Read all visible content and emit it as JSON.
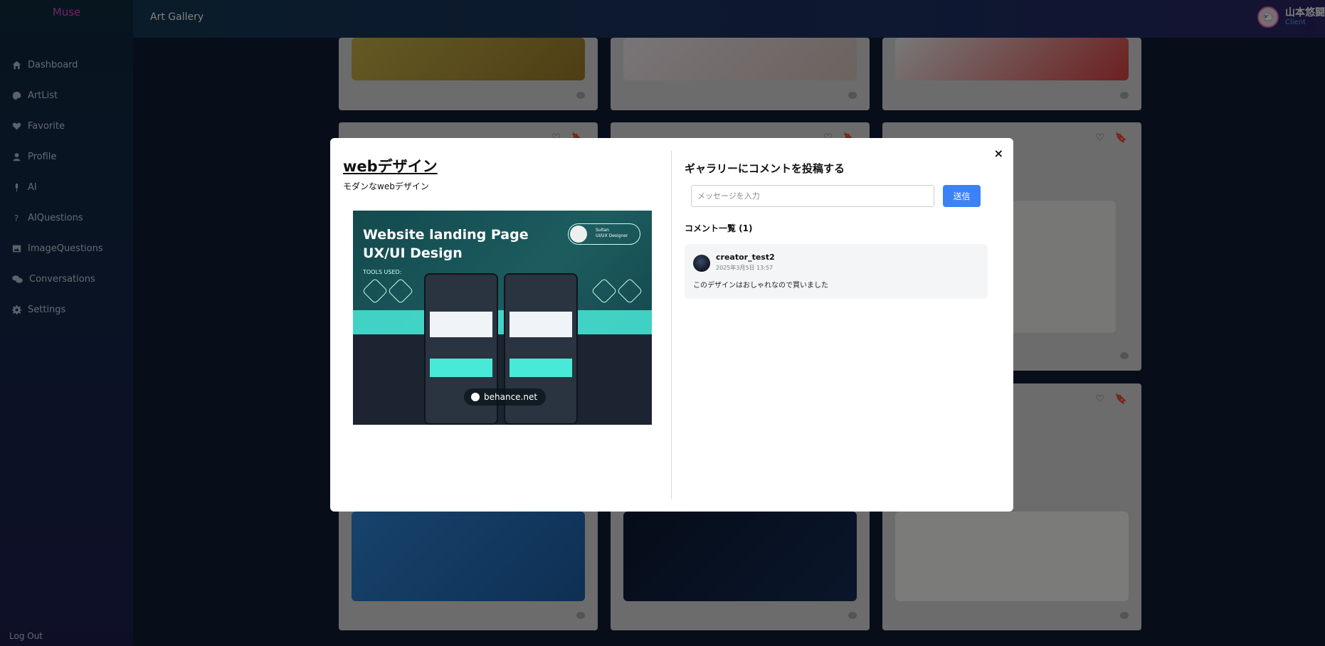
{
  "sidebar": {
    "brand": "Muse",
    "items": [
      {
        "label": "Dashboard",
        "icon": "home-icon"
      },
      {
        "label": "ArtList",
        "icon": "palette-icon"
      },
      {
        "label": "Favorite",
        "icon": "heart-icon"
      },
      {
        "label": "Profile",
        "icon": "user-icon"
      },
      {
        "label": "AI",
        "icon": "microphone-icon"
      },
      {
        "label": "AIQuestions",
        "icon": "question-icon"
      },
      {
        "label": "ImageQuestions",
        "icon": "image-icon"
      },
      {
        "label": "Conversations",
        "icon": "chat-icon"
      },
      {
        "label": "Settings",
        "icon": "gear-icon"
      }
    ],
    "logout_label": "Log Out"
  },
  "header": {
    "title": "Art Gallery",
    "user": {
      "name": "山本悠闘",
      "role": "Client"
    }
  },
  "modal": {
    "close_label": "×",
    "art": {
      "title": "webデザイン",
      "subtitle": "モダンなwebデザイン",
      "image": {
        "heading_line1": "Website landing Page",
        "heading_line2": "UX/UI Design",
        "tools_label": "TOOLS USED:",
        "designer_name": "Sultan",
        "designer_role": "UI/UX Designer",
        "watermark": "behance.net"
      }
    },
    "comments": {
      "post_title": "ギャラリーにコメントを投稿する",
      "input_placeholder": "メッセージを入力",
      "send_label": "送信",
      "list_heading": "コメント一覧 (1)",
      "items": [
        {
          "user": "creator_test2",
          "date": "2025年3月5日 13:57",
          "text": "このデザインはおしゃれなので買いました"
        }
      ]
    }
  },
  "colors": {
    "accent": "#3b82f6",
    "brand": "#d84ec9",
    "role": "#5fa8ff"
  }
}
